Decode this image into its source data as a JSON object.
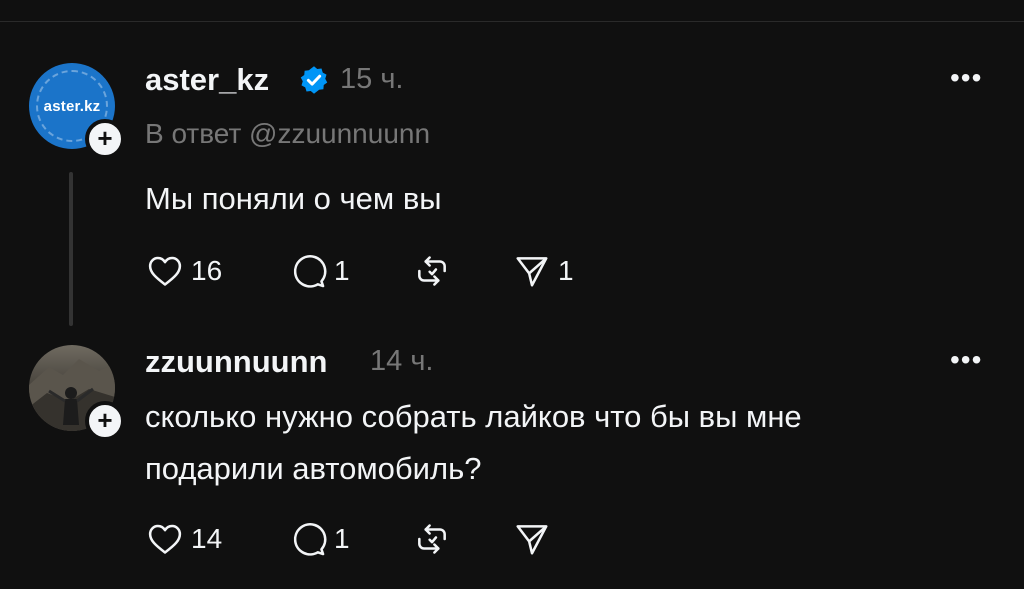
{
  "posts": [
    {
      "username": "aster_kz",
      "verified": true,
      "time": "15 ч.",
      "reply_to": "В ответ @zzuunnuunn",
      "text": "Мы поняли о чем вы",
      "avatar_logo": "aster.kz",
      "likes": "16",
      "comments": "1",
      "reposts": "",
      "shares": "1",
      "more_label": "•••"
    },
    {
      "username": "zzuunnuunn",
      "verified": false,
      "time": "14 ч.",
      "text_line1": "сколько нужно собрать лайков что бы вы мне",
      "text_line2": "подарили автомобиль?",
      "likes": "14",
      "comments": "1",
      "reposts": "",
      "shares": "",
      "more_label": "•••"
    }
  ],
  "colors": {
    "background": "#101010",
    "text": "#f3f5f7",
    "muted": "#777777",
    "verified": "#0095f6"
  },
  "icons": [
    "heart-icon",
    "comment-icon",
    "repost-icon",
    "share-icon",
    "verified-icon",
    "more-icon",
    "plus-icon"
  ]
}
